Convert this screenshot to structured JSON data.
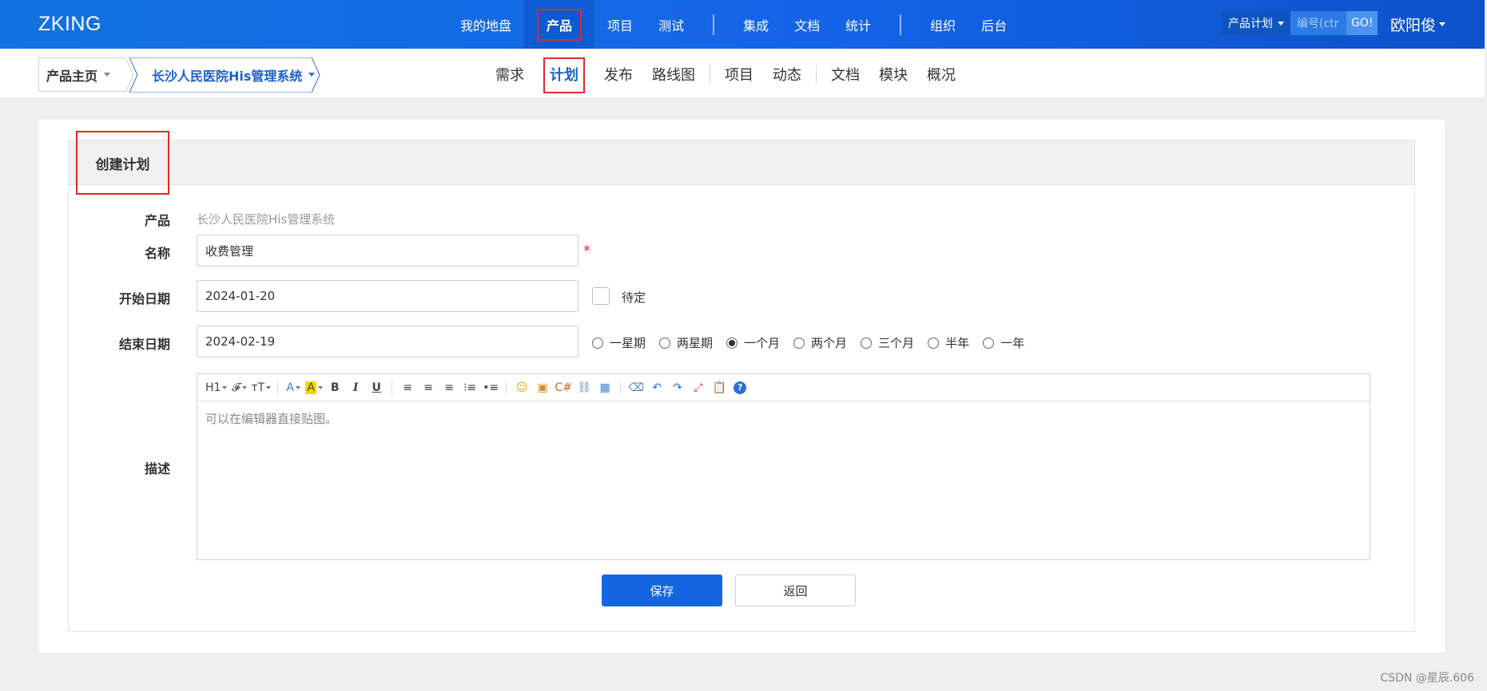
{
  "app": {
    "logo": "ZKING"
  },
  "main_nav": {
    "items": [
      {
        "label": "我的地盘",
        "name": "nav-my-dashboard",
        "active": false
      },
      {
        "label": "产品",
        "name": "nav-product",
        "active": true
      },
      {
        "label": "项目",
        "name": "nav-project",
        "active": false
      },
      {
        "label": "测试",
        "name": "nav-test",
        "active": false
      },
      {
        "sep": true
      },
      {
        "label": "集成",
        "name": "nav-integration",
        "active": false
      },
      {
        "label": "文档",
        "name": "nav-docs",
        "active": false
      },
      {
        "label": "统计",
        "name": "nav-stats",
        "active": false
      },
      {
        "sep": true
      },
      {
        "label": "组织",
        "name": "nav-org",
        "active": false
      },
      {
        "label": "后台",
        "name": "nav-admin",
        "active": false
      }
    ]
  },
  "search": {
    "type_label": "产品计划",
    "placeholder": "编号(ctr",
    "go_label": "GO!"
  },
  "user": {
    "name": "欧阳俊"
  },
  "breadcrumb": {
    "home": "产品主页",
    "product": "长沙人民医院His管理系统"
  },
  "sub_nav": {
    "items": [
      {
        "label": "需求",
        "name": "subnav-story",
        "active": false
      },
      {
        "label": "计划",
        "name": "subnav-plan",
        "active": true
      },
      {
        "label": "发布",
        "name": "subnav-release",
        "active": false
      },
      {
        "label": "路线图",
        "name": "subnav-roadmap",
        "active": false
      },
      {
        "sep": true
      },
      {
        "label": "项目",
        "name": "subnav-project",
        "active": false
      },
      {
        "label": "动态",
        "name": "subnav-dynamic",
        "active": false
      },
      {
        "sep": true
      },
      {
        "label": "文档",
        "name": "subnav-docs",
        "active": false
      },
      {
        "label": "模块",
        "name": "subnav-module",
        "active": false
      },
      {
        "label": "概况",
        "name": "subnav-overview",
        "active": false
      }
    ]
  },
  "form": {
    "title": "创建计划",
    "product_label": "产品",
    "product_value": "长沙人民医院His管理系统",
    "name_label": "名称",
    "name_value": "收费管理",
    "required_mark": "*",
    "begin_label": "开始日期",
    "begin_value": "2024-01-20",
    "pending_label": "待定",
    "end_label": "结束日期",
    "end_value": "2024-02-19",
    "durations": [
      {
        "label": "一星期",
        "checked": false
      },
      {
        "label": "两星期",
        "checked": false
      },
      {
        "label": "一个月",
        "checked": true
      },
      {
        "label": "两个月",
        "checked": false
      },
      {
        "label": "三个月",
        "checked": false
      },
      {
        "label": "半年",
        "checked": false
      },
      {
        "label": "一年",
        "checked": false
      }
    ],
    "desc_label": "描述",
    "desc_placeholder": "可以在编辑器直接贴图。",
    "save_label": "保存",
    "back_label": "返回"
  },
  "editor_toolbar": [
    {
      "label": "H1",
      "name": "heading-icon",
      "drop": true
    },
    {
      "label": "𝓕",
      "name": "font-family-icon",
      "drop": true
    },
    {
      "label": "тT",
      "name": "font-size-icon",
      "drop": true
    },
    {
      "sep": true
    },
    {
      "label": "A",
      "name": "font-color-icon",
      "drop": true,
      "color": "#3b7be0"
    },
    {
      "label": "A",
      "name": "highlight-color-icon",
      "drop": true,
      "bg": "#f5d800"
    },
    {
      "label": "B",
      "name": "bold-icon",
      "bold": true
    },
    {
      "label": "I",
      "name": "italic-icon",
      "italic": true
    },
    {
      "label": "U",
      "name": "underline-icon",
      "underline": true
    },
    {
      "sep": true
    },
    {
      "label": "≡",
      "name": "align-left-icon"
    },
    {
      "label": "≡",
      "name": "align-center-icon"
    },
    {
      "label": "≡",
      "name": "align-right-icon"
    },
    {
      "label": "⁝≡",
      "name": "ordered-list-icon"
    },
    {
      "label": "•≡",
      "name": "unordered-list-icon"
    },
    {
      "sep": true
    },
    {
      "label": "☺",
      "name": "emoticon-icon",
      "color": "#e0a800"
    },
    {
      "label": "▣",
      "name": "image-icon",
      "color": "#d48a1a"
    },
    {
      "label": "C#",
      "name": "code-icon",
      "color": "#c06a2a"
    },
    {
      "label": "⛓",
      "name": "link-icon",
      "color": "#6f8fb5"
    },
    {
      "label": "▦",
      "name": "table-icon",
      "color": "#3a7fcf"
    },
    {
      "sep": true
    },
    {
      "label": "⌫",
      "name": "eraser-icon",
      "color": "#5a7fb0"
    },
    {
      "label": "↶",
      "name": "undo-icon",
      "color": "#2a74d6"
    },
    {
      "label": "↷",
      "name": "redo-icon",
      "color": "#2a74d6"
    },
    {
      "label": "⤢",
      "name": "fullscreen-icon",
      "color": "#d04040"
    },
    {
      "label": "📋",
      "name": "paste-icon",
      "color": "#555"
    },
    {
      "label": "?",
      "name": "help-icon",
      "circle": true
    }
  ],
  "watermark": "CSDN @星辰.606"
}
